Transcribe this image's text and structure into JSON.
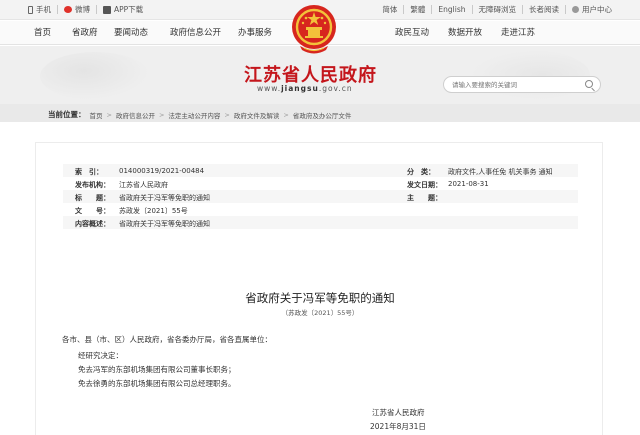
{
  "topbar": {
    "left": [
      {
        "icon": "phone-icon",
        "label": "手机"
      },
      {
        "icon": "weibo-icon",
        "label": "微博"
      },
      {
        "icon": "app-icon",
        "label": "APP下载"
      }
    ],
    "right": [
      {
        "label": "简体"
      },
      {
        "label": "繁體"
      },
      {
        "label": "English"
      },
      {
        "label": "无障碍浏览"
      },
      {
        "label": "长者阅读"
      },
      {
        "icon": "user-icon",
        "label": "用户中心"
      }
    ]
  },
  "nav": {
    "left": [
      "首页",
      "省政府",
      "要闻动态",
      "政府信息公开",
      "办事服务"
    ],
    "right": [
      "政民互动",
      "数据开放",
      "走进江苏"
    ]
  },
  "site": {
    "title": "江苏省人民政府",
    "url_bold": "jiangsu",
    "url_rest": ".gov.cn",
    "url_prefix": "www."
  },
  "search": {
    "placeholder": "请输入要搜索的关键词"
  },
  "breadcrumb": {
    "label": "当前位置：",
    "items": [
      "首页",
      "政府信息公开",
      "法定主动公开内容",
      "政府文件及解读",
      "省政府及办公厅文件"
    ]
  },
  "meta": {
    "index_key": "索　引：",
    "index_val": "014000319/2021-00484",
    "category_key": "分　类：",
    "category_val": "政府文件,人事任免 机关事务 通知",
    "org_key": "发布机构：",
    "org_val": "江苏省人民政府",
    "date_key": "发文日期：",
    "date_val": "2021-08-31",
    "title_key": "标　　题：",
    "title_val": "省政府关于冯军等免职的通知",
    "subject_key": "主　　题：",
    "subject_val": "",
    "docno_key": "文　　号：",
    "docno_val": "苏政发〔2021〕55号",
    "summary_key": "内容概述：",
    "summary_val": "省政府关于冯军等免职的通知"
  },
  "doc": {
    "title": "省政府关于冯军等免职的通知",
    "number": "（苏政发〔2021〕55号）",
    "addressee": "各市、县（市、区）人民政府，省各委办厅局，省各直属单位：",
    "p1": "经研究决定：",
    "p2": "免去冯军的东部机场集团有限公司董事长职务；",
    "p3": "免去徐勇的东部机场集团有限公司总经理职务。",
    "signature": "江苏省人民政府",
    "date": "2021年8月31日"
  }
}
